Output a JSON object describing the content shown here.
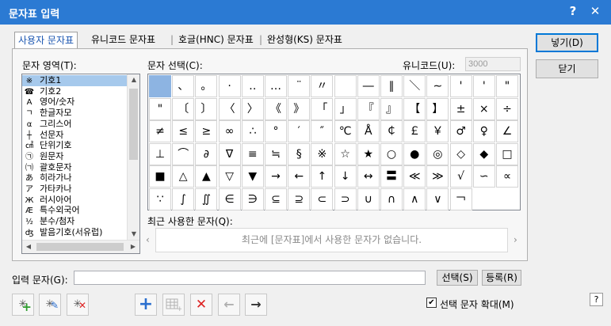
{
  "window": {
    "title": "문자표 입력",
    "help_glyph": "?",
    "close_glyph": "✕"
  },
  "tabs": [
    {
      "label": "사용자 문자표"
    },
    {
      "label": "유니코드 문자표"
    },
    {
      "label": "|"
    },
    {
      "label": "호글(HNC) 문자표"
    },
    {
      "label": "|"
    },
    {
      "label": "완성형(KS) 문자표"
    }
  ],
  "area": {
    "label": "문자 영역(T):",
    "items": [
      {
        "icon": "※",
        "label": "기호1"
      },
      {
        "icon": "☎",
        "label": "기호2"
      },
      {
        "icon": "A",
        "label": "영어/숫자"
      },
      {
        "icon": "ㄱ",
        "label": "한글자모"
      },
      {
        "icon": "α",
        "label": "그리스어"
      },
      {
        "icon": "┼",
        "label": "선문자"
      },
      {
        "icon": "㎠",
        "label": "단위기호"
      },
      {
        "icon": "㉠",
        "label": "원문자"
      },
      {
        "icon": "㈀",
        "label": "괄호문자"
      },
      {
        "icon": "あ",
        "label": "히라가나"
      },
      {
        "icon": "ア",
        "label": "가타카나"
      },
      {
        "icon": "Ж",
        "label": "러시아어"
      },
      {
        "icon": "Æ",
        "label": "특수외국어"
      },
      {
        "icon": "½",
        "label": "분수/첨자"
      },
      {
        "icon": "ʤ",
        "label": "발음기호(서유럽)"
      }
    ]
  },
  "selection": {
    "label": "문자 선택(C):",
    "unicode_label": "유니코드(U):",
    "unicode_value": "3000",
    "symbols": [
      " ",
      "、",
      "。",
      "·",
      "‥",
      "…",
      "¨",
      "〃",
      "­",
      "―",
      "∥",
      "＼",
      "∼",
      "'",
      "'",
      "\"",
      "\"",
      "〔",
      "〕",
      "〈",
      "〉",
      "《",
      "》",
      "「",
      "」",
      "『",
      "』",
      "【",
      "】",
      "±",
      "×",
      "÷",
      "≠",
      "≤",
      "≥",
      "∞",
      "∴",
      "°",
      "′",
      "″",
      "℃",
      "Å",
      "￠",
      "￡",
      "￥",
      "♂",
      "♀",
      "∠",
      "⊥",
      "⌒",
      "∂",
      "∇",
      "≡",
      "≒",
      "§",
      "※",
      "☆",
      "★",
      "○",
      "●",
      "◎",
      "◇",
      "◆",
      "□",
      "■",
      "△",
      "▲",
      "▽",
      "▼",
      "→",
      "←",
      "↑",
      "↓",
      "↔",
      "〓",
      "≪",
      "≫",
      "√",
      "∽",
      "∝",
      "∵",
      "∫",
      "∬",
      "∈",
      "∋",
      "⊆",
      "⊇",
      "⊂",
      "⊃",
      "∪",
      "∩",
      "∧",
      "∨",
      "￢"
    ]
  },
  "recent": {
    "label": "최근 사용한 문자(Q):",
    "empty": "최근에 [문자표]에서 사용한 문자가 없습니다."
  },
  "input": {
    "label": "입력 문자(G):",
    "value": "",
    "select_button": "선택(S)",
    "register_button": "등록(R)"
  },
  "buttons": {
    "insert": "넣기(D)",
    "close": "닫기"
  },
  "options": {
    "enlarge_label": "선택 문자 확대(M)",
    "enlarge_checked": true
  },
  "toolbar": {
    "add": "+",
    "delete": "✕",
    "back": "←",
    "forward": "→"
  },
  "help": "?"
}
